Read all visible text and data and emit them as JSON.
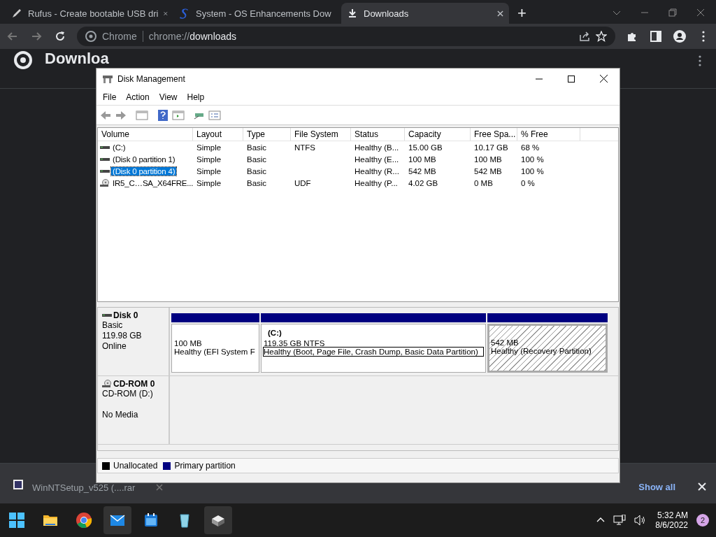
{
  "browser": {
    "tabs": [
      {
        "title": "Rufus - Create bootable USB dri",
        "selected": false
      },
      {
        "title": "System - OS Enhancements Dow",
        "selected": false
      },
      {
        "title": "Downloads",
        "selected": true
      }
    ],
    "new_tab": "+",
    "address": {
      "site": "Chrome",
      "prefix": "chrome://",
      "host": "downloads"
    },
    "page_title": "Downloa"
  },
  "disk_management": {
    "title": "Disk Management",
    "menu": [
      "File",
      "Action",
      "View",
      "Help"
    ],
    "columns": [
      "Volume",
      "Layout",
      "Type",
      "File System",
      "Status",
      "Capacity",
      "Free Spa...",
      "% Free"
    ],
    "rows": [
      {
        "kind": "disk",
        "selected": false,
        "cells": [
          "(C:)",
          "Simple",
          "Basic",
          "NTFS",
          "Healthy (B...",
          "15.00 GB",
          "10.17 GB",
          "68 %"
        ]
      },
      {
        "kind": "disk",
        "selected": false,
        "cells": [
          "(Disk 0 partition 1)",
          "Simple",
          "Basic",
          "",
          "Healthy (E...",
          "100 MB",
          "100 MB",
          "100 %"
        ]
      },
      {
        "kind": "disk",
        "selected": true,
        "cells": [
          "(Disk 0 partition 4)",
          "Simple",
          "Basic",
          "",
          "Healthy (R...",
          "542 MB",
          "542 MB",
          "100 %"
        ]
      },
      {
        "kind": "cd",
        "selected": false,
        "cells": [
          "IR5_C…SA_X64FRE...",
          "Simple",
          "Basic",
          "UDF",
          "Healthy (P...",
          "4.02 GB",
          "0 MB",
          "0 %"
        ]
      }
    ],
    "disks": [
      {
        "kind": "disk",
        "name": "Disk 0",
        "lines": [
          "Basic",
          "119.98 GB",
          "Online"
        ],
        "partitions": [
          {
            "size": "100 MB",
            "status": "Healthy (EFI System F",
            "selected": false,
            "focused": false
          },
          {
            "name": "(C:)",
            "size": "119.35 GB NTFS",
            "status": "Healthy (Boot, Page File, Crash Dump, Basic Data Partition)",
            "selected": false,
            "focused": true
          },
          {
            "size": "542 MB",
            "status": "Healthy (Recovery Partition)",
            "selected": true,
            "focused": false
          }
        ]
      },
      {
        "kind": "cd",
        "name": "CD-ROM 0",
        "lines": [
          "CD-ROM (D:)"
        ],
        "note": "No Media"
      }
    ],
    "legend": [
      {
        "label": "Unallocated",
        "color": "#000000"
      },
      {
        "label": "Primary partition",
        "color": "#000080"
      }
    ]
  },
  "shelf": {
    "item": "WinNTSetup_v525 (....rar",
    "show_all": "Show all"
  },
  "taskbar": {
    "apps": [
      {
        "kind": "explorer",
        "active": false
      },
      {
        "kind": "chrome",
        "active": false
      },
      {
        "kind": "mail",
        "active": true
      },
      {
        "kind": "calendar",
        "active": false
      },
      {
        "kind": "bin",
        "active": false
      },
      {
        "kind": "drive",
        "active": true
      }
    ],
    "time": "5:32 AM",
    "date": "8/6/2022",
    "badge": "2"
  }
}
